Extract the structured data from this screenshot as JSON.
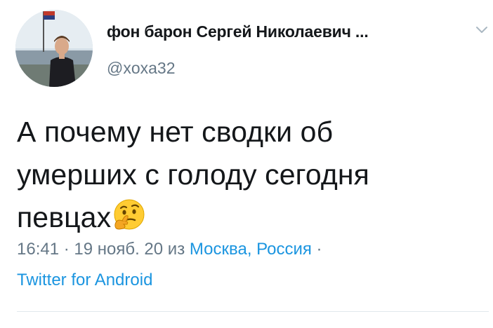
{
  "author": {
    "display_name": "фон барон Сергей Николаевич ...",
    "handle": "@xoxa32"
  },
  "tweet": {
    "text_line1": "А почему нет сводки об",
    "text_line2": "умерших с голоду сегодня",
    "text_line3": "певцах",
    "emoji_icon": "thinking-face-icon"
  },
  "meta": {
    "time": "16:41",
    "separator1": " · ",
    "date": "19 нояб. 20",
    "from_word": " из ",
    "location": "Москва, Россия",
    "separator2": " ·",
    "client": "Twitter for Android"
  },
  "colors": {
    "link": "#1b95e0",
    "secondary_text": "#657786",
    "primary_text": "#14171a"
  }
}
